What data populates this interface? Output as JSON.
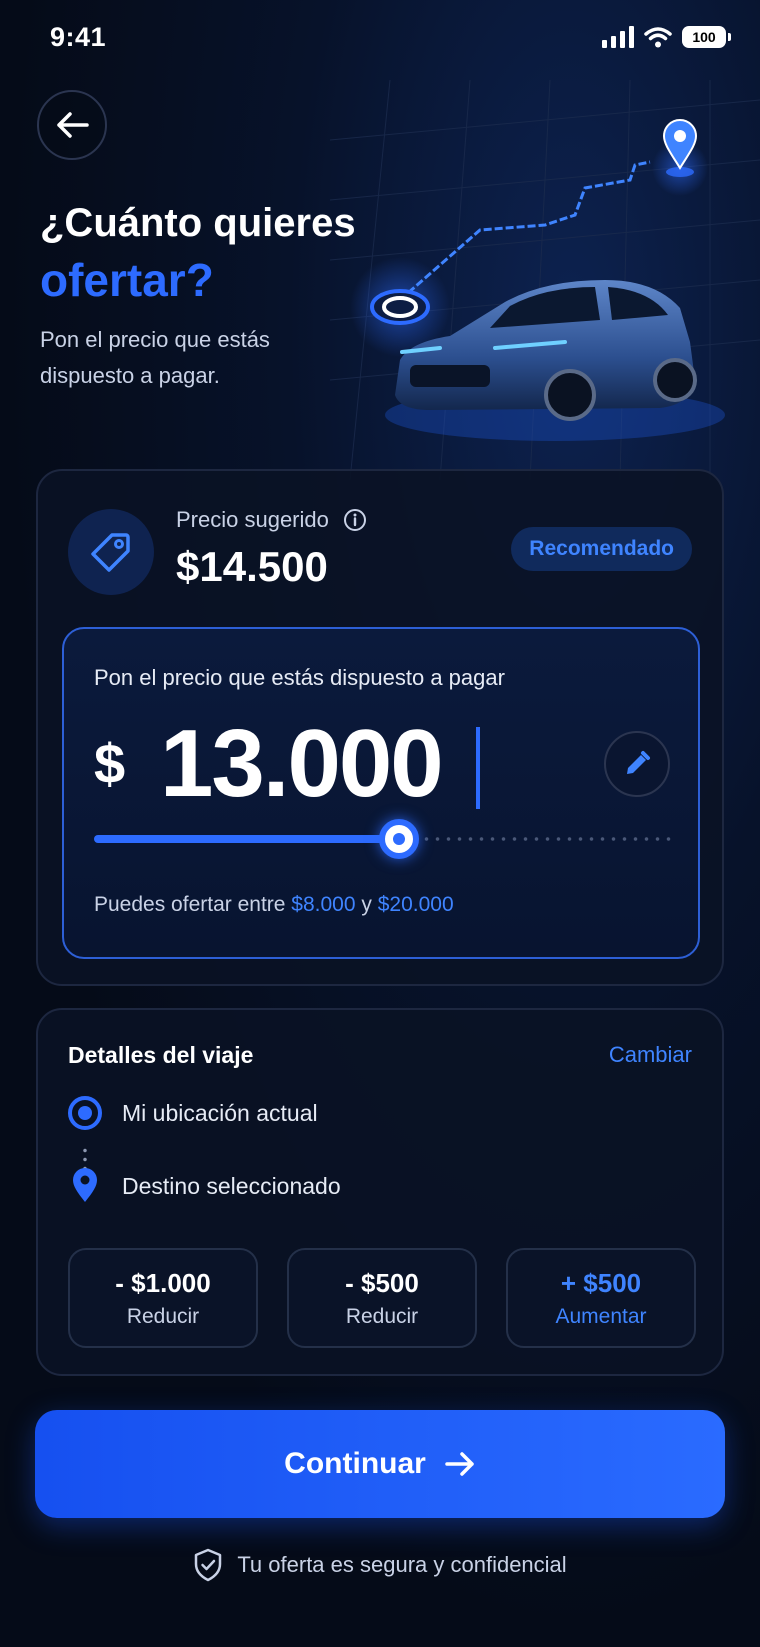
{
  "status_bar": {
    "time": "9:41",
    "battery": "100"
  },
  "header": {
    "title_line1": "¿Cuánto quieres",
    "title_line2": "ofertar?",
    "subtitle": "Pon el precio que estás dispuesto a pagar."
  },
  "suggested": {
    "label": "Precio sugerido",
    "value": "$14.500",
    "badge": "Recomendado"
  },
  "offer": {
    "label": "Pon el precio que estás dispuesto a pagar",
    "currency": "$",
    "amount": "13.000",
    "slider_fraction": 0.525,
    "range_prefix": "Puedes ofertar entre",
    "range_min": "$8.000",
    "range_connector": "y",
    "range_max": "$20.000"
  },
  "trip": {
    "title": "Detalles del viaje",
    "change_label": "Cambiar",
    "origin": "Mi ubicación actual",
    "destination": "Destino seleccionado"
  },
  "adjust_buttons": [
    {
      "amount": "- $1.000",
      "action": "Reducir"
    },
    {
      "amount": "- $500",
      "action": "Reducir"
    },
    {
      "amount": "+ $500",
      "action": "Aumentar"
    }
  ],
  "cta": {
    "label": "Continuar"
  },
  "footer": {
    "secure_note": "Tu oferta es segura y confidencial"
  },
  "colors": {
    "accent": "#2d6bff",
    "background": "#050b18",
    "card": "#0a1224"
  },
  "icons": [
    "signal-icon",
    "wifi-icon",
    "battery-icon",
    "back-arrow-icon",
    "location-pin-icon",
    "car-image",
    "price-tag-icon",
    "info-icon",
    "edit-pencil-icon",
    "origin-dot-icon",
    "destination-pin-icon",
    "arrow-right-icon",
    "shield-check-icon"
  ]
}
